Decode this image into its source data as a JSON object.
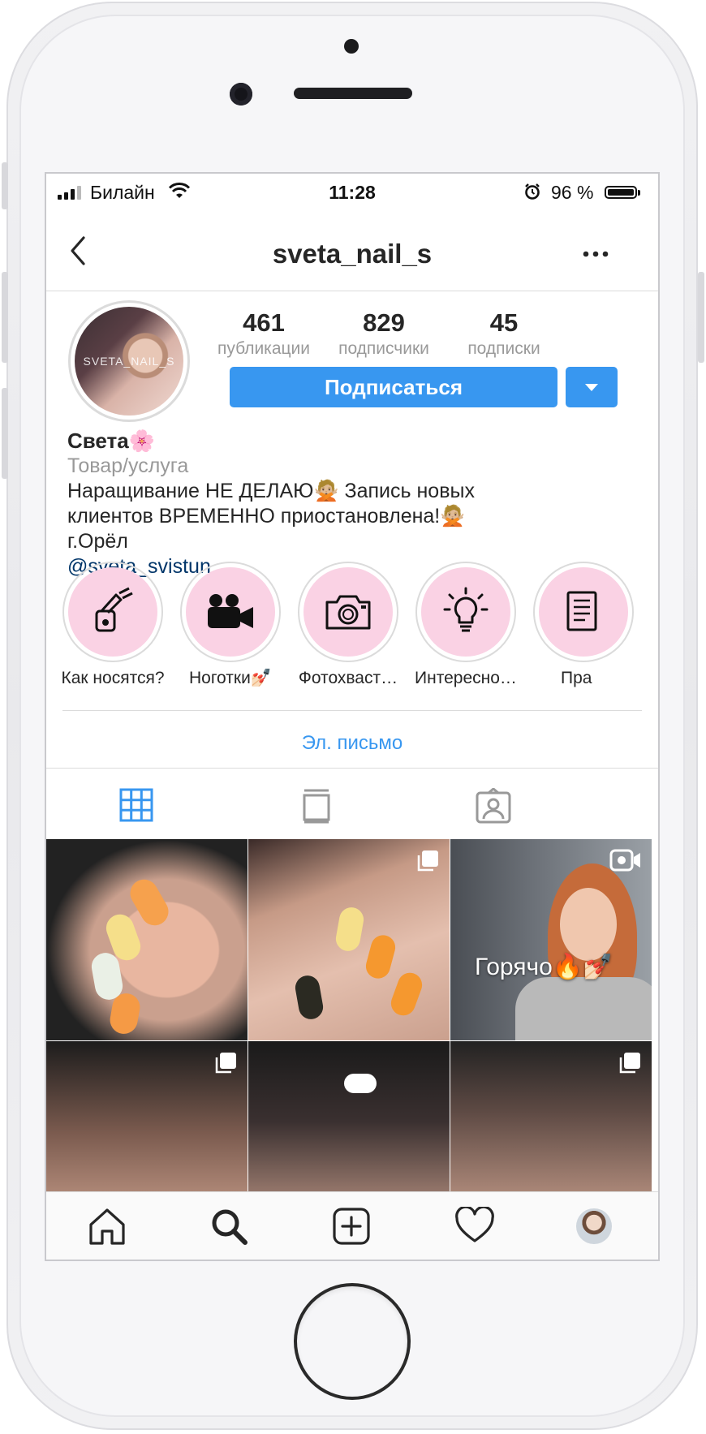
{
  "status_bar": {
    "carrier": "Билайн",
    "time": "11:28",
    "battery": "96 %"
  },
  "nav": {
    "username": "sveta_nail_s",
    "back_icon": "chevron-left-icon",
    "more_icon": "ellipsis-icon"
  },
  "profile": {
    "avatar_text": "SVETA_NAIL_S",
    "stats": [
      {
        "value": "461",
        "label": "публикации"
      },
      {
        "value": "829",
        "label": "подписчики"
      },
      {
        "value": "45",
        "label": "подписки"
      }
    ],
    "subscribe_label": "Подписаться"
  },
  "bio": {
    "name": "Света🌸",
    "category": "Товар/услуга",
    "line1": "Наращивание НЕ ДЕЛАЮ🙅🏼 Запись новых",
    "line2": "клиентов ВРЕМЕННО приостановлена!🙅🏼",
    "line3": "г.Орёл",
    "link": "@sveta_svistun"
  },
  "highlights": [
    {
      "label": "Как носятся?",
      "icon": "nail-polish-icon"
    },
    {
      "label": "Ноготки💅🏻",
      "icon": "video-camera-icon"
    },
    {
      "label": "Фотохваст…",
      "icon": "camera-icon"
    },
    {
      "label": "Интересно…",
      "icon": "lightbulb-icon"
    },
    {
      "label": "Пра",
      "icon": "document-icon"
    }
  ],
  "contact": {
    "email_label": "Эл. письмо"
  },
  "tabs": [
    {
      "name": "grid",
      "active": true
    },
    {
      "name": "feed",
      "active": false
    },
    {
      "name": "tagged",
      "active": false
    }
  ],
  "posts": [
    {
      "overlay": ""
    },
    {
      "overlay": ""
    },
    {
      "overlay": "Горячо🔥💅🏻"
    },
    {
      "overlay": ""
    },
    {
      "overlay": ""
    },
    {
      "overlay": ""
    }
  ],
  "colors": {
    "accent": "#3897f0",
    "highlight_bg": "#fad2e4",
    "link": "#003569",
    "muted": "#999999"
  }
}
